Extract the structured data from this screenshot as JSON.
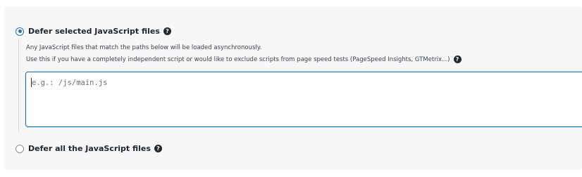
{
  "option_selected": {
    "label": "Defer selected JavaScript files",
    "help_icon": "question-circle-icon",
    "checked": true
  },
  "description": {
    "line1": "Any JavaScript files that match the paths below will be loaded asynchronously.",
    "line2": "Use this if you have a completely independent script or would like to exclude scripts from page speed tests (PageSpeed Insights, GTMetrix...)"
  },
  "paths_field": {
    "value": "",
    "placeholder": "e.g.: /js/main.js"
  },
  "option_all": {
    "label": "Defer all the JavaScript files",
    "help_icon": "question-circle-icon",
    "checked": false
  },
  "colors": {
    "accent": "#2271b1",
    "panel_bg": "#f7f7f8",
    "text": "#23282d"
  }
}
